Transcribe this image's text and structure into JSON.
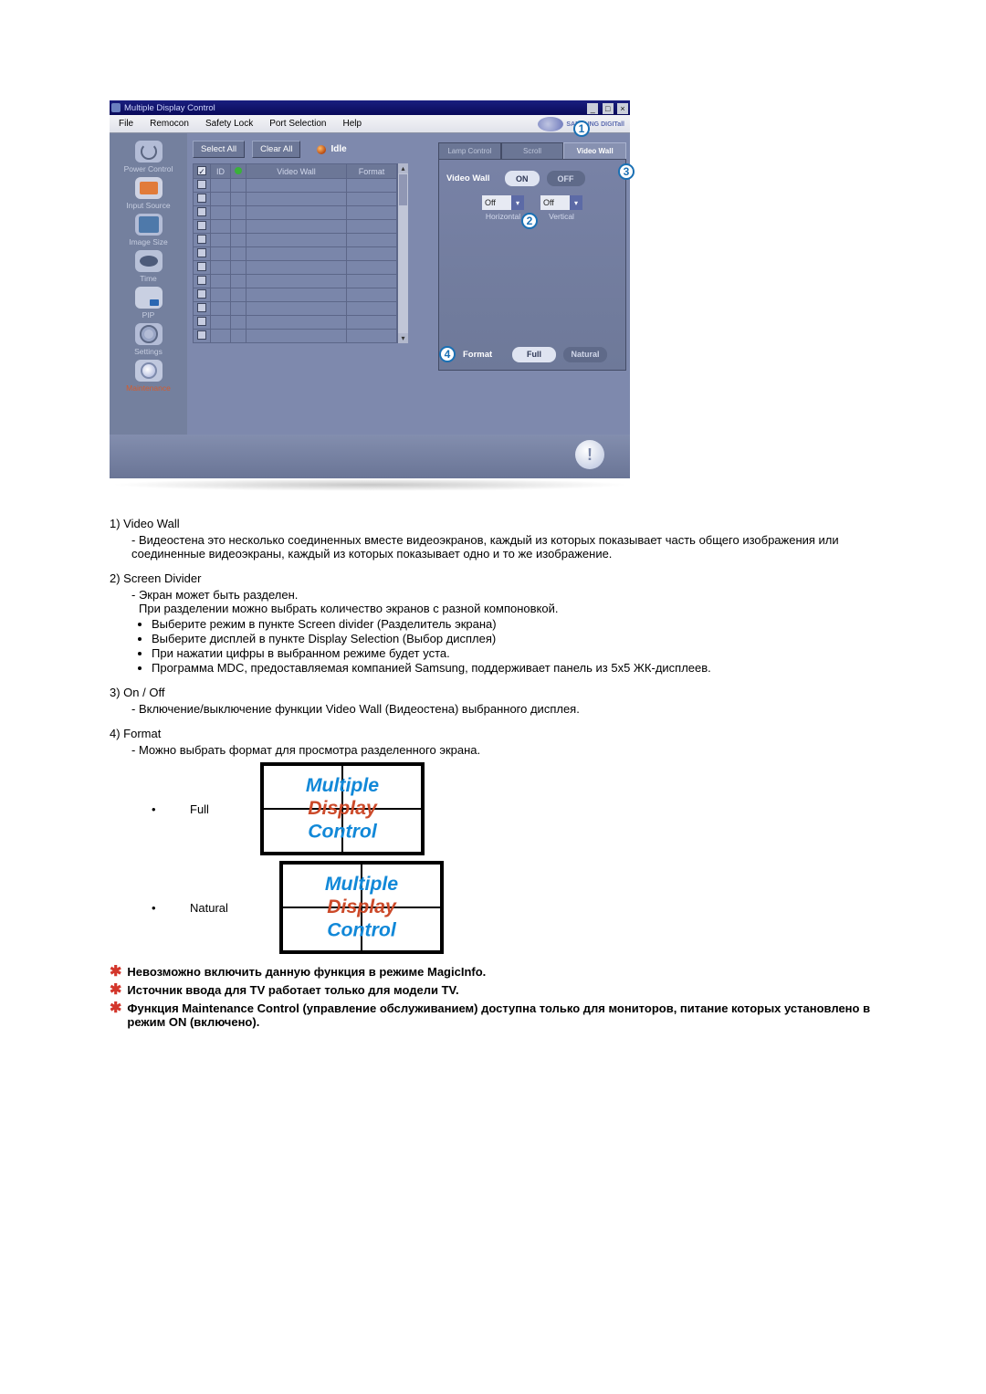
{
  "app": {
    "title": "Multiple Display Control",
    "brand": "SAMSUNG DIGITall",
    "menu": [
      "File",
      "Remocon",
      "Safety Lock",
      "Port Selection",
      "Help"
    ],
    "sidebar": [
      {
        "label": "Power Control",
        "icon": "power"
      },
      {
        "label": "Input Source",
        "icon": "input"
      },
      {
        "label": "Image Size",
        "icon": "imgsz"
      },
      {
        "label": "Time",
        "icon": "time"
      },
      {
        "label": "PIP",
        "icon": "pip"
      },
      {
        "label": "Settings",
        "icon": "sett"
      },
      {
        "label": "Maintenance",
        "icon": "maint",
        "active": true
      }
    ],
    "buttons": {
      "select_all": "Select All",
      "clear_all": "Clear All"
    },
    "idle_label": "Idle",
    "list": {
      "headers": {
        "id": "ID",
        "video_wall": "Video Wall",
        "format": "Format"
      },
      "rows": 12
    },
    "tabs": {
      "lamp": "Lamp Control",
      "scroll": "Scroll",
      "video_wall": "Video Wall"
    },
    "panel": {
      "vw_label": "Video Wall",
      "on": "ON",
      "off": "OFF",
      "h_value": "Off",
      "v_value": "Off",
      "h_label": "Horizontal",
      "v_label": "Vertical",
      "fmt_label": "Format",
      "full": "Full",
      "natural": "Natural"
    },
    "callouts": {
      "c1": "1",
      "c2": "2",
      "c3": "3",
      "c4": "4"
    }
  },
  "doc": {
    "i1": {
      "head": "1)  Video Wall",
      "l1": "- Видеостена это несколько соединенных вместе видеоэкранов, каждый из которых показывает часть общего изображения или соединенные видеоэкраны, каждый из которых показывает одно и то же изображение."
    },
    "i2": {
      "head": "2)  Screen Divider",
      "l1": "- Экран может быть разделен.",
      "l2": "При разделении можно выбрать количество экранов с разной компоновкой.",
      "b1": "Выберите режим в пункте Screen divider (Разделитель экрана)",
      "b2": "Выберите дисплей в пункте Display Selection (Выбор дисплея)",
      "b3": "При нажатии цифры в выбранном режиме будет уста.",
      "b4": "Программа MDC, предоставляемая компанией Samsung, поддерживает панель из 5x5 ЖК-дисплеев."
    },
    "i3": {
      "head": "3)  On / Off",
      "l1": "- Включение/выключение функции Video Wall (Видеостена) выбранного дисплея."
    },
    "i4": {
      "head": "4)  Format",
      "l1": "- Можно выбрать формат для просмотра разделенного экрана.",
      "full": "Full",
      "natural": "Natural",
      "logo1": "Multiple",
      "logo2": "Display",
      "logo3": "Control"
    },
    "notes": {
      "n1": "Невозможно включить данную функция в режиме MagicInfo.",
      "n2": "Источник ввода для TV работает только для модели TV.",
      "n3": "Функция Maintenance Control (управление обслуживанием) доступна только для мониторов, питание которых установлено в режим ON (включено)."
    }
  }
}
